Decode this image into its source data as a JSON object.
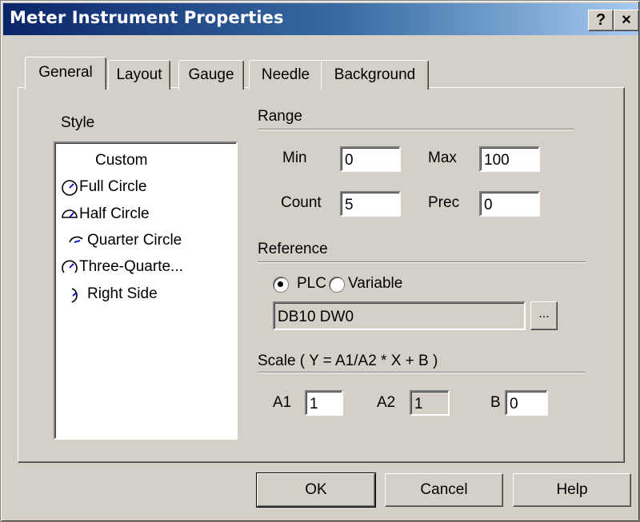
{
  "window": {
    "title": "Meter Instrument Properties",
    "help_btn": "?",
    "close_btn": "×"
  },
  "tabs": [
    {
      "label": "General",
      "active": true
    },
    {
      "label": "Layout"
    },
    {
      "label": "Gauge"
    },
    {
      "label": "Needle"
    },
    {
      "label": "Background"
    }
  ],
  "style": {
    "label": "Style",
    "items": [
      {
        "label": "Custom",
        "icon": "none"
      },
      {
        "label": "Full Circle",
        "icon": "full-circle-gauge-icon"
      },
      {
        "label": "Half Circle",
        "icon": "half-circle-gauge-icon"
      },
      {
        "label": "Quarter Circle",
        "icon": "quarter-circle-gauge-icon"
      },
      {
        "label": "Three-Quarte...",
        "icon": "three-quarter-gauge-icon"
      },
      {
        "label": "Right Side",
        "icon": "right-side-gauge-icon"
      }
    ]
  },
  "range": {
    "label": "Range",
    "min_label": "Min",
    "min_value": "0",
    "max_label": "Max",
    "max_value": "100",
    "count_label": "Count",
    "count_value": "5",
    "prec_label": "Prec",
    "prec_value": "0"
  },
  "reference": {
    "label": "Reference",
    "plc_label": "PLC",
    "variable_label": "Variable",
    "selected": "PLC",
    "address_value": "DB10 DW0",
    "browse_label": "..."
  },
  "scale": {
    "label": "Scale  ( Y = A1/A2  * X + B )",
    "a1_label": "A1",
    "a1_value": "1",
    "a2_label": "A2",
    "a2_value": "1",
    "b_label": "B",
    "b_value": "0"
  },
  "buttons": {
    "ok": "OK",
    "cancel": "Cancel",
    "help": "Help"
  },
  "colors": {
    "title_start": "#0a246a",
    "title_end": "#a6caf0",
    "face": "#d4d0c8"
  }
}
